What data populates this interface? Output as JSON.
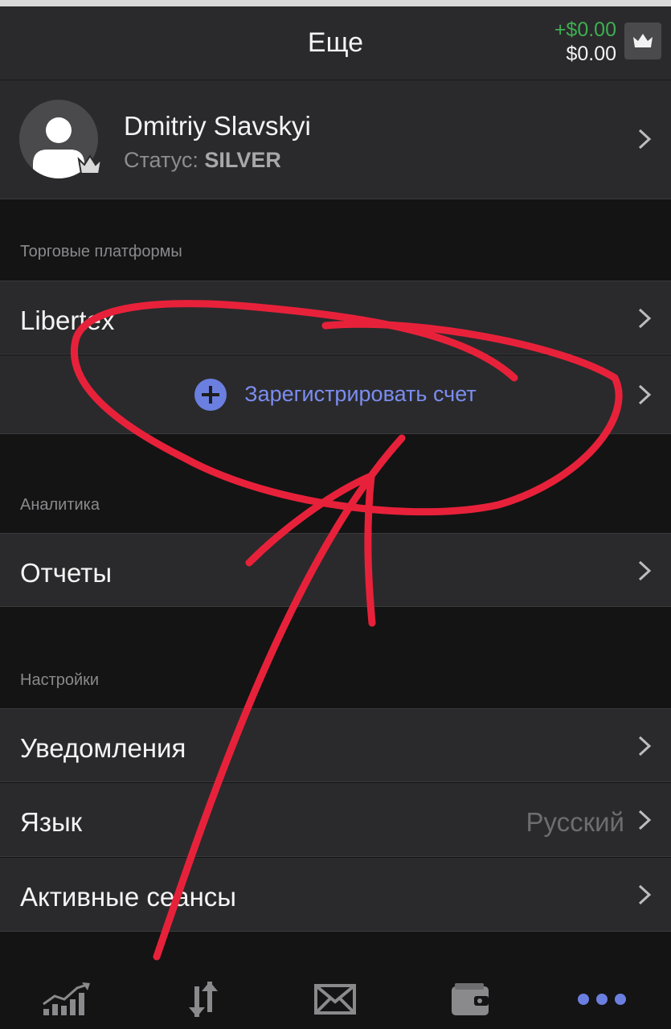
{
  "header": {
    "title": "Еще",
    "profit": "+$0.00",
    "equity": "$0.00",
    "crown_icon": "crown-icon"
  },
  "profile": {
    "name": "Dmitriy Slavskyi",
    "status_prefix": "Статус: ",
    "status_value": "SILVER"
  },
  "sections": {
    "platforms": "Торговые платформы",
    "analytics": "Аналитика",
    "settings": "Настройки"
  },
  "rows": {
    "libertex": "Libertex",
    "register": "Зарегистрировать счет",
    "reports": "Отчеты",
    "notifications": "Уведомления",
    "language": "Язык",
    "language_value": "Русский",
    "sessions": "Активные сеансы"
  },
  "tabbar": {
    "items": [
      "chart-icon",
      "transfer-icon",
      "mail-icon",
      "wallet-icon",
      "more-icon"
    ]
  },
  "colors": {
    "profit": "#3fae52",
    "accent": "#7b8df0",
    "annotation": "#e8213a"
  }
}
